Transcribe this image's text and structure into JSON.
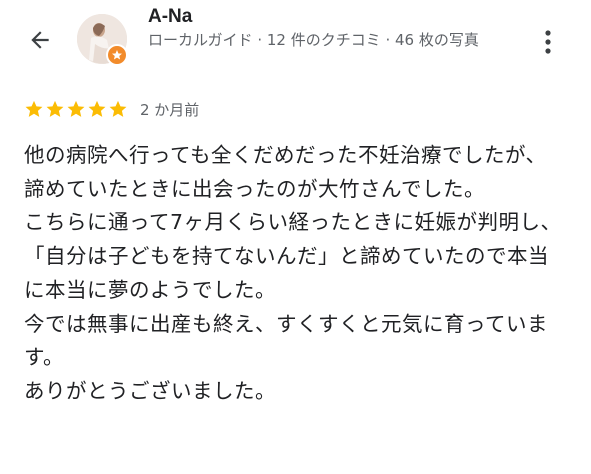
{
  "reviewer": {
    "name": "A-Na",
    "meta": "ローカルガイド · 12 件のクチコミ · 46 枚の写真",
    "badge_color": "#f28b2b"
  },
  "icons": {
    "back": "arrow-back-icon",
    "more": "more-vert-icon",
    "badge": "local-guide-star-icon",
    "star": "star-icon"
  },
  "review": {
    "rating": 5,
    "date": "2 か月前",
    "star_color": "#fbbc04",
    "paragraphs": [
      "他の病院へ行っても全くだめだった不妊治療でしたが、諦めていたときに出会ったのが大竹さんでした。",
      "こちらに通って7ヶ月くらい経ったときに妊娠が判明し、「自分は子どもを持てないんだ」と諦めていたので本当に本当に夢のようでした。",
      "今では無事に出産も終え、すくすくと元気に育っています。",
      "ありがとうございました。"
    ]
  }
}
